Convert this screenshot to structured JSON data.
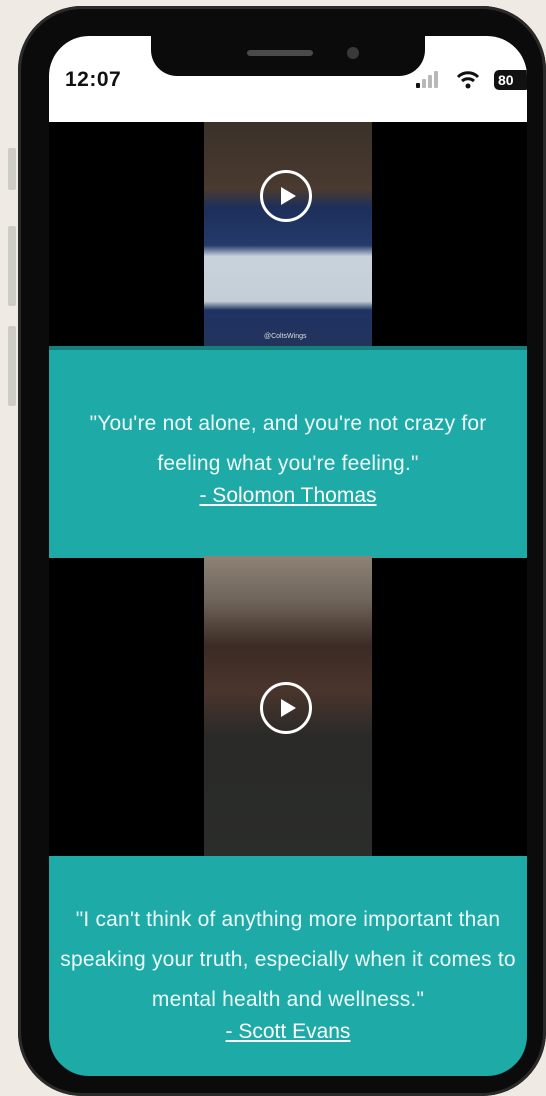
{
  "status_bar": {
    "time": "12:07",
    "battery": "80"
  },
  "videos": [
    {
      "watermark": "@ColtsWings"
    },
    {
      "watermark": ""
    }
  ],
  "quotes": [
    {
      "text": "\"You're not alone, and you're not crazy for feeling what you're feeling.\"",
      "author": "- Solomon Thomas"
    },
    {
      "text": "\"I can't think of anything more important than speaking your truth, especially when it comes to mental health and wellness.\"",
      "author": "- Scott Evans"
    }
  ],
  "colors": {
    "accent": "#1eaaa6",
    "background": "#efebe4"
  }
}
